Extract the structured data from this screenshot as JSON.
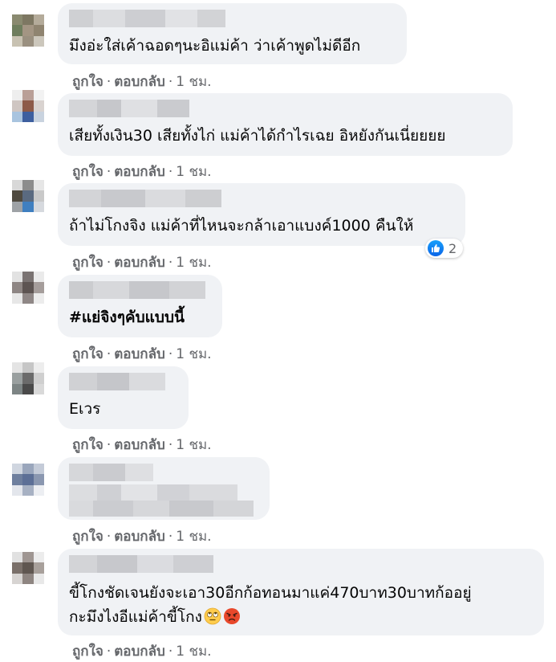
{
  "actions": {
    "like": "ถูกใจ",
    "reply": "ตอบกลับ",
    "separator": "·",
    "time": "1 ชม."
  },
  "comments": [
    {
      "text": "มึงอ่ะใส่เค้าฉอดๆนะอิแม่ค้า ว่าเค้าพูดไม่ดีอีก"
    },
    {
      "text": "เสียทั้งเงิน30 เสียทั้งไก่ แม่ค้าได้กำไรเฉย อิหยังกันเนี่ยยยย"
    },
    {
      "text": "ถ้าไม่โกงจิง แม่ค้าที่ไหนจะกล้าเอาแบงค์1000 คืนให้",
      "reaction_count": "2"
    },
    {
      "text": "#แย่จิงๆคับแบบนี้"
    },
    {
      "text": "Eเวร"
    },
    {
      "text": ""
    },
    {
      "line1": "ขี้โกงชัดเจนยังจะเอา30อีกก้อทอนมาแค่470บาท30บาทก้ออยู่",
      "line2": "กะมึงไงอีแม่ค้าขี้โกง"
    }
  ],
  "icons": {
    "like_reaction": "thumbs-up-icon",
    "emoji_1": "rolling-eyes-emoji-icon",
    "emoji_2": "angry-face-emoji-icon"
  },
  "colors": {
    "bubble": "#f0f2f5",
    "secondary_text": "#65676b",
    "like_blue": "#1877f2"
  }
}
